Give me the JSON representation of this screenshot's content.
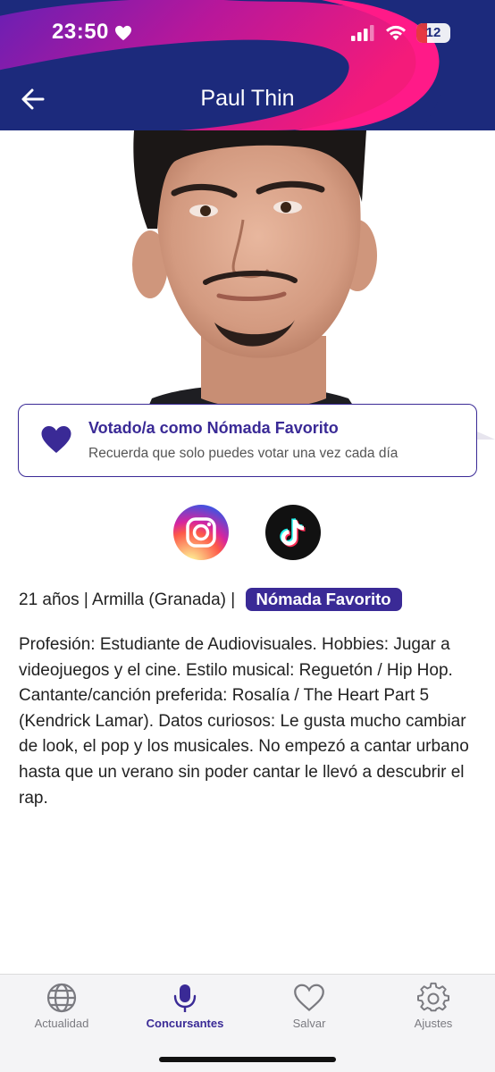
{
  "status_bar": {
    "time": "23:50",
    "battery": "12"
  },
  "header": {
    "title": "Paul Thin"
  },
  "vote_card": {
    "title": "Votado/a como Nómada Favorito",
    "subtitle": "Recuerda que solo puedes votar una vez cada día"
  },
  "social": {
    "items": [
      {
        "name": "instagram-icon"
      },
      {
        "name": "tiktok-icon"
      }
    ]
  },
  "profile": {
    "details": "21 años | Armilla (Granada) |",
    "badge": "Nómada Favorito",
    "bio": "Profesión: Estudiante de Audiovisuales.  Hobbies: Jugar a videojuegos y el cine.   Estilo musical: Reguetón / Hip Hop.  Cantante/canción preferida: Rosalía / The Heart Part 5 (Kendrick Lamar).  Datos curiosos: Le gusta mucho cambiar de look, el pop y los musicales. No empezó a cantar urbano hasta que un verano sin poder cantar le llevó a descubrir el rap."
  },
  "tabbar": {
    "tabs": [
      {
        "label": "Actualidad",
        "icon": "globe-icon",
        "active": false
      },
      {
        "label": "Concursantes",
        "icon": "microphone-icon",
        "active": true
      },
      {
        "label": "Salvar",
        "icon": "heart-icon",
        "active": false
      },
      {
        "label": "Ajustes",
        "icon": "gear-icon",
        "active": false
      }
    ]
  },
  "colors": {
    "header_bg": "#1c2a7c",
    "accent": "#3a2a96",
    "header_swoosh": "#e0108c"
  }
}
